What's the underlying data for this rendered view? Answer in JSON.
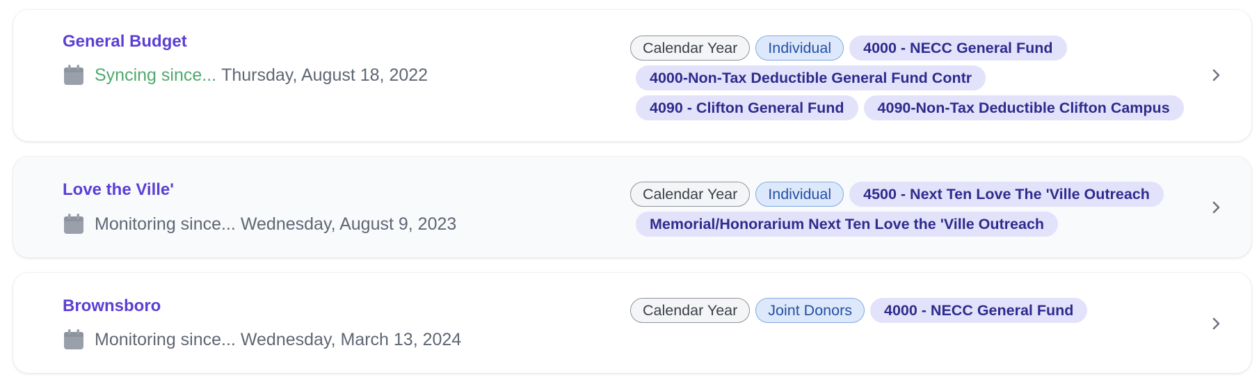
{
  "cards": [
    {
      "title": "General Budget",
      "status": "Syncing since...",
      "date": "Thursday, August 18, 2022",
      "tags": {
        "period": "Calendar Year",
        "kind": "Individual",
        "funds": [
          "4000 - NECC General Fund",
          "4000-Non-Tax Deductible General Fund Contr",
          "4090 - Clifton General Fund",
          "4090-Non-Tax Deductible Clifton Campus"
        ]
      }
    },
    {
      "title": "Love the Ville'",
      "status": "Monitoring since...",
      "date": "Wednesday, August 9, 2023",
      "tags": {
        "period": "Calendar Year",
        "kind": "Individual",
        "funds": [
          "4500 - Next Ten Love The 'Ville Outreach",
          "Memorial/Honorarium Next Ten Love the 'Ville Outreach"
        ]
      }
    },
    {
      "title": "Brownsboro",
      "status": "Monitoring since...",
      "date": "Wednesday, March 13, 2024",
      "tags": {
        "period": "Calendar Year",
        "kind": "Joint Donors",
        "funds": [
          "4000 - NECC General Fund"
        ]
      }
    }
  ],
  "icons": {
    "calendar": "calendar-icon",
    "chevron": "chevron-right-icon"
  },
  "colors": {
    "title": "#5b3fd3",
    "syncing": "#4fa96d",
    "muted": "#5f6673",
    "fund_tag_bg": "#e3e2fb"
  }
}
